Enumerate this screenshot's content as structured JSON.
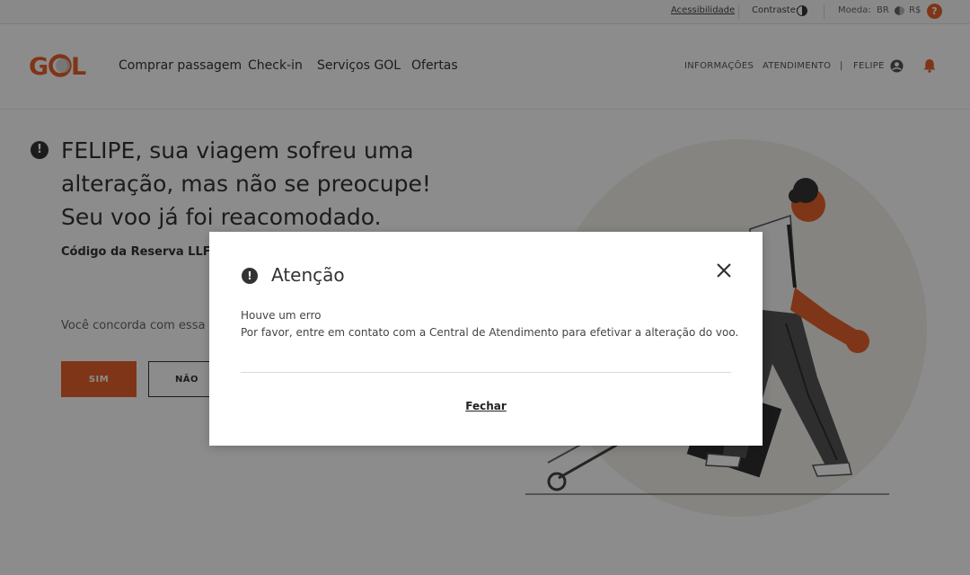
{
  "topbar": {
    "accessibility": "Acessibilidade",
    "contrast": "Contraste:",
    "currency_label": "Moeda:",
    "country": "BR",
    "currency": "R$",
    "help": "?"
  },
  "header": {
    "nav": [
      "Comprar passagem",
      "Check-in",
      "Serviços GOL",
      "Ofertas"
    ],
    "info": "INFORMAÇÕES",
    "support": "ATENDIMENTO",
    "separator": "|",
    "user": "FELIPE"
  },
  "main": {
    "headline_lines": [
      "FELIPE, sua viagem sofreu uma",
      "alteração, mas não se preocupe!",
      "Seu voo já foi reacomodado."
    ],
    "reservation_code": "Código da Reserva LLFGPI",
    "question": "Você concorda com essa alt",
    "yes": "SIM",
    "no": "NÃO"
  },
  "modal": {
    "title": "Atenção",
    "message1": "Houve um erro",
    "message2": "Por favor, entre em contato com a Central de Atendimento para efetivar a alteração do voo.",
    "close_label": "Fechar"
  },
  "colors": {
    "brand_orange": "#e8622a",
    "overlay": "rgba(0,0,0,0.45)",
    "text_dark": "#333333"
  },
  "icons": [
    "contrast-icon",
    "flag-icon",
    "help-icon",
    "user-icon",
    "bell-icon",
    "alert-icon",
    "close-icon"
  ]
}
